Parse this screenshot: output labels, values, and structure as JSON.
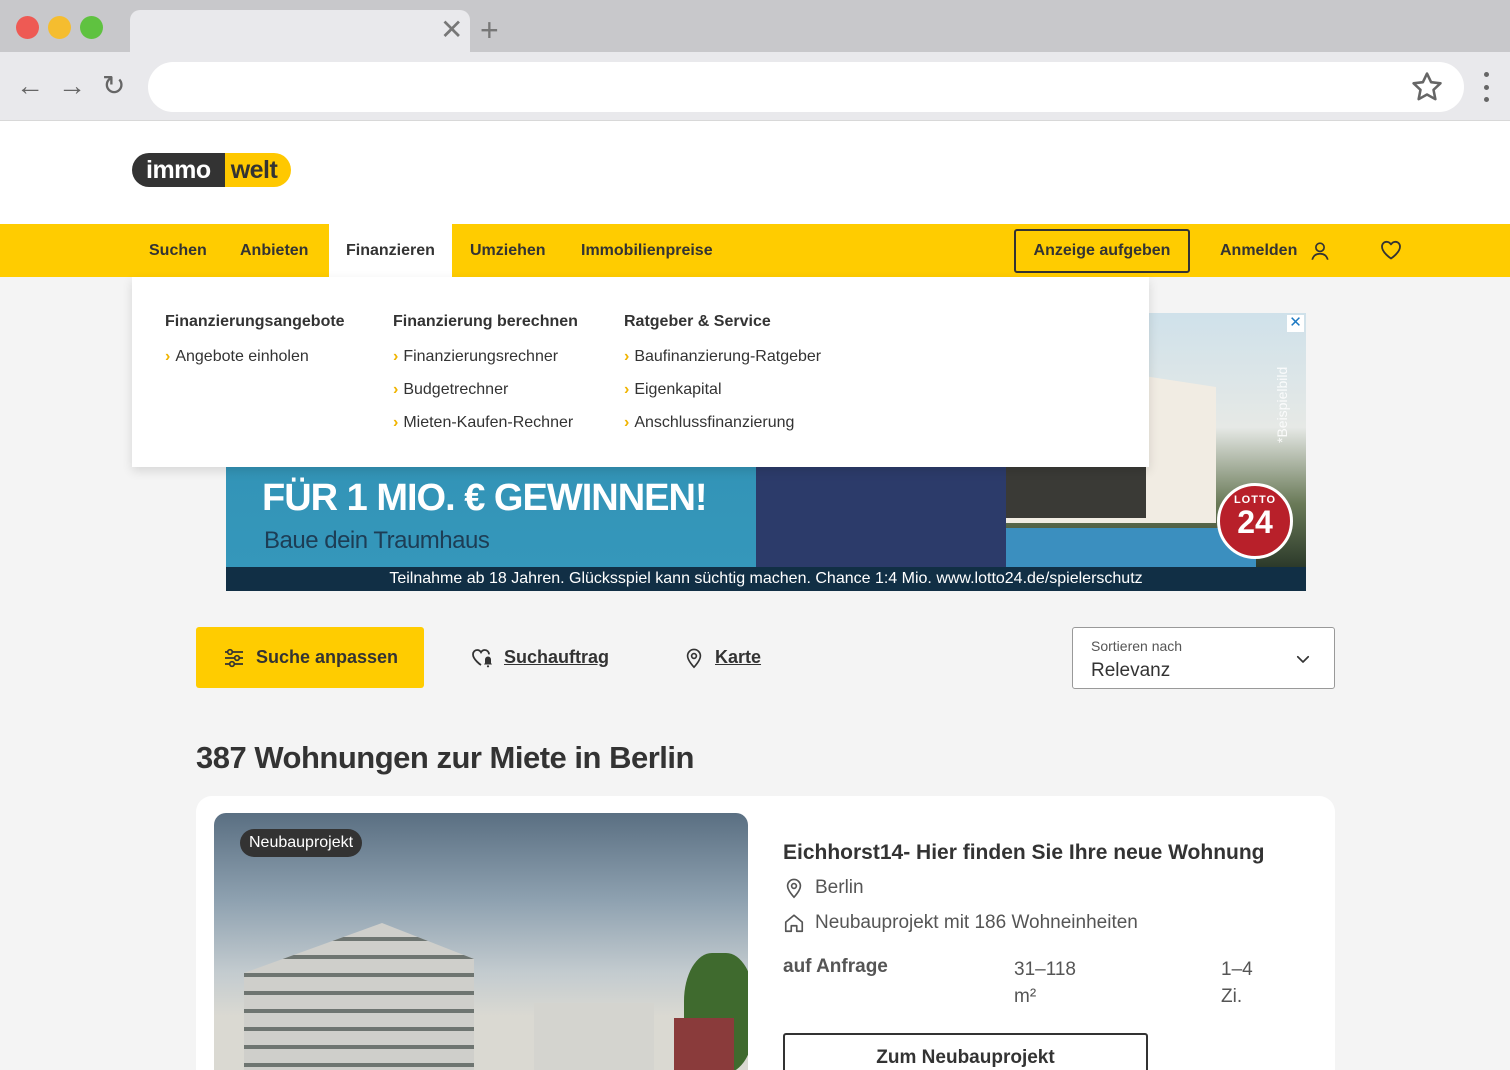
{
  "browser": {
    "tab_close": "✕",
    "tab_new": "+",
    "back": "←",
    "forward": "→",
    "reload": "↻",
    "url": ""
  },
  "logo": {
    "part1": "immo",
    "part2": "welt"
  },
  "nav": {
    "items": [
      "Suchen",
      "Anbieten",
      "Finanzieren",
      "Umziehen",
      "Immobilienpreise"
    ],
    "active": "Finanzieren",
    "cta": "Anzeige aufgeben",
    "login": "Anmelden"
  },
  "dropdown": {
    "columns": [
      {
        "title": "Finanzierungsangebote",
        "links": [
          "Angebote einholen"
        ]
      },
      {
        "title": "Finanzierung berechnen",
        "links": [
          "Finanzierungsrechner",
          "Budgetrechner",
          "Mieten-Kaufen-Rechner"
        ]
      },
      {
        "title": "Ratgeber & Service",
        "links": [
          "Baufinanzierung-Ratgeber",
          "Eigenkapital",
          "Anschlussfinanzierung"
        ]
      }
    ]
  },
  "ad": {
    "headline": "FÜR 1 MIO. € GEWINNEN!",
    "sub": "Baue dein Traumhaus",
    "note": "*Beispielbild",
    "lotto_top": "LOTTO",
    "lotto_num": "24",
    "close": "✕",
    "footer": "Teilnahme ab 18 Jahren. Glücksspiel kann süchtig machen. Chance 1:4 Mio. www.lotto24.de/spielerschutz"
  },
  "toolbar": {
    "adjust": "Suche anpassen",
    "search_order": "Suchauftrag",
    "map": "Karte",
    "sort_label": "Sortieren nach",
    "sort_value": "Relevanz"
  },
  "results": {
    "heading": "387 Wohnungen zur Miete in Berlin",
    "listings": [
      {
        "badge": "Neubauprojekt",
        "title": "Eichhorst14- Hier finden Sie Ihre neue Wohnung",
        "location": "Berlin",
        "type": "Neubauprojekt mit 186 Wohneinheiten",
        "price": "auf Anfrage",
        "area_value": "31–118",
        "area_unit": "m²",
        "rooms_value": "1–4",
        "rooms_unit": "Zi.",
        "button": "Zum Neubauprojekt"
      }
    ]
  },
  "colors": {
    "brand_yellow": "#ffcc00",
    "dark": "#333333"
  }
}
